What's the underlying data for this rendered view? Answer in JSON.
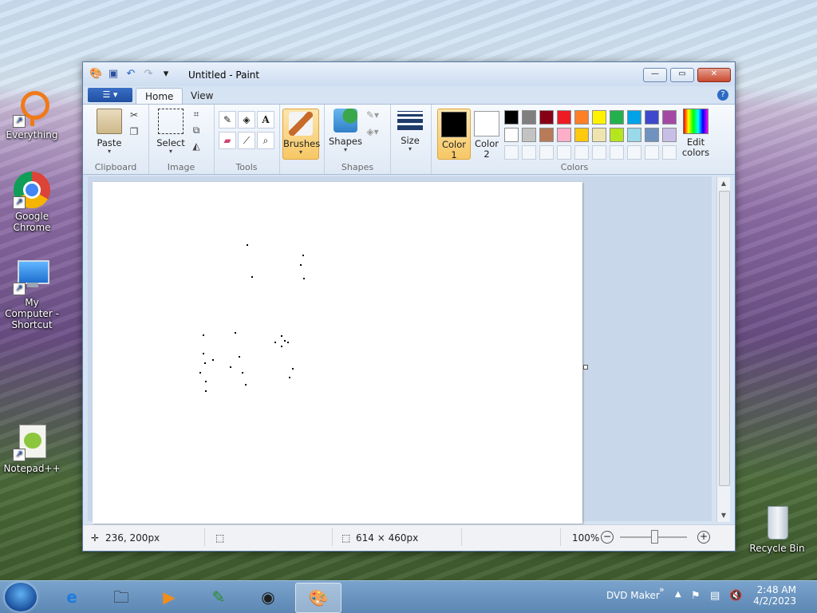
{
  "desktop": {
    "icons": [
      {
        "label": "Everything"
      },
      {
        "label": "Google Chrome"
      },
      {
        "label": "My Computer - Shortcut"
      },
      {
        "label": "Notepad++"
      },
      {
        "label": "Recycle Bin"
      }
    ]
  },
  "window": {
    "title": "Untitled - Paint",
    "controls": {
      "minimize": "—",
      "maximize": "▭",
      "close": "✕"
    }
  },
  "ribbon": {
    "file_menu_icon": "☰ ▾",
    "tabs": [
      {
        "label": "Home"
      },
      {
        "label": "View"
      }
    ],
    "groups": {
      "clipboard": {
        "label": "Clipboard",
        "paste": "Paste"
      },
      "image": {
        "label": "Image",
        "select": "Select"
      },
      "tools": {
        "label": "Tools"
      },
      "brushes": {
        "label": "Brushes"
      },
      "shapes": {
        "label": "Shapes",
        "shapes_btn": "Shapes"
      },
      "size": {
        "label": "Size"
      },
      "colors": {
        "label": "Colors",
        "color1": "Color 1",
        "color2": "Color 2",
        "edit": "Edit colors",
        "color1_value": "#000000",
        "color2_value": "#ffffff",
        "palette_row1": [
          "#000000",
          "#7f7f7f",
          "#880015",
          "#ed1c24",
          "#ff7f27",
          "#fff200",
          "#22b14c",
          "#00a2e8",
          "#3f48cc",
          "#a349a4"
        ],
        "palette_row2": [
          "#ffffff",
          "#c3c3c3",
          "#b97a57",
          "#ffaec9",
          "#ffc90e",
          "#efe4b0",
          "#b5e61d",
          "#99d9ea",
          "#7092be",
          "#c8bfe7"
        ]
      }
    }
  },
  "statusbar": {
    "cursor_pos": "236, 200px",
    "canvas_size": "614 × 460px",
    "zoom": "100%"
  },
  "taskbar": {
    "tray_label": "DVD Maker",
    "time": "2:48 AM",
    "date": "4/2/2023"
  }
}
